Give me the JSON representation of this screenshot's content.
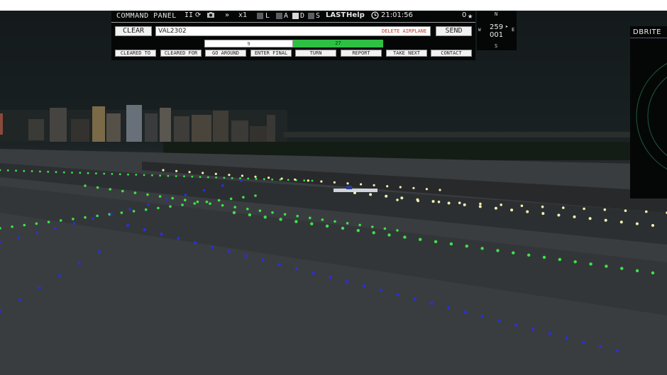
{
  "panel": {
    "title": "COMMAND PANEL",
    "controls": {
      "pause": "II",
      "reset": "⟳",
      "camera": "📷",
      "fast_forward": "»",
      "speed": "x1"
    },
    "filters": [
      {
        "label": "L",
        "active": false
      },
      {
        "label": "A",
        "active": false
      },
      {
        "label": "D",
        "active": true
      },
      {
        "label": "S",
        "active": false
      }
    ],
    "last_label": "LAST",
    "help_label": "Help",
    "time": "21:01:56",
    "score": "0",
    "clear_label": "CLEAR",
    "callsign": "VAL2302",
    "delete_label": "DELETE AIRPLANE",
    "send_label": "SEND",
    "runways": [
      {
        "label": "9",
        "selected": false
      },
      {
        "label": "27",
        "selected": true
      }
    ],
    "commands": [
      "CLEARED TO",
      "CLEARED FOR",
      "GO AROUND",
      "ENTER FINAL",
      "TURN",
      "REPORT",
      "TAKE NEXT",
      "CONTACT"
    ]
  },
  "heading": {
    "north": "N",
    "south": "S",
    "east": "E",
    "west": "W",
    "value_top": "259",
    "value_bottom": "001"
  },
  "radar": {
    "title": "DBRITE"
  },
  "colors": {
    "taxiway_light": "#3ee24a",
    "edge_light": "#2b2fd6",
    "runway_light": "#f4f1b0",
    "selected_runway": "#2fbf44"
  }
}
